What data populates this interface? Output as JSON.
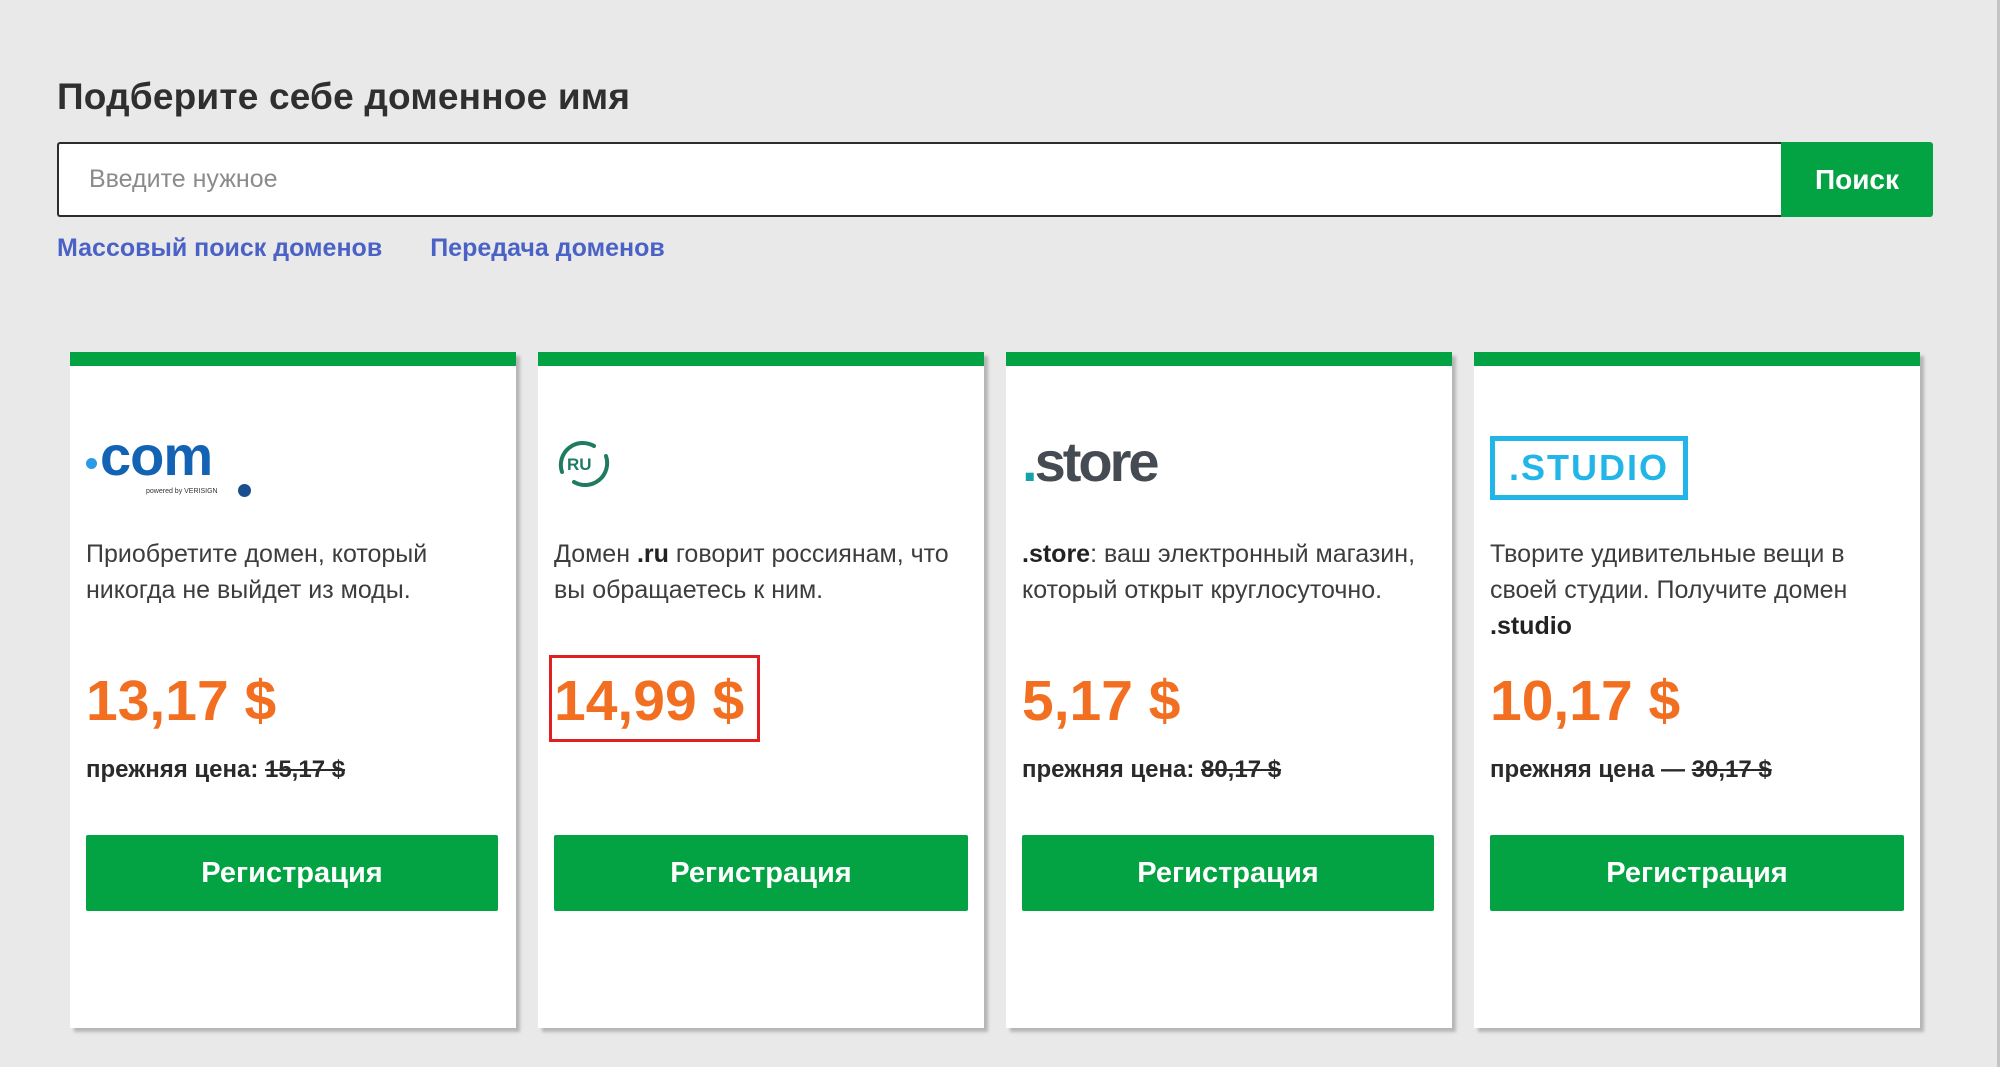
{
  "header": {
    "title": "Подберите себе доменное имя"
  },
  "search": {
    "placeholder": "Введите нужное",
    "value": "",
    "button_label": "Поиск"
  },
  "links": {
    "bulk_search": "Массовый поиск доменов",
    "transfer": "Передача доменов"
  },
  "colors": {
    "accent_green": "#03a344",
    "price_orange": "#f26f21",
    "link_blue": "#4a62c6",
    "highlight_red": "#e02020"
  },
  "cards": [
    {
      "zone": "com",
      "logo_text": "com",
      "logo_sub": "powered by VERISIGN",
      "desc": "Приобретите домен, который никогда не выйдет из моды.",
      "price": "13,17 $",
      "old_price_label": "прежняя цена:",
      "old_price_value": "15,17 $",
      "button_label": "Регистрация"
    },
    {
      "zone": "ru",
      "logo_text": "RU",
      "desc_prefix": "Домен ",
      "desc_bold": ".ru",
      "desc_suffix": " говорит россиянам, что вы обращаетесь к ним.",
      "price": "14,99 $",
      "price_highlighted": true,
      "button_label": "Регистрация"
    },
    {
      "zone": "store",
      "logo_text": "store",
      "desc_bold": ".store",
      "desc_suffix": ": ваш электронный магазин, который открыт круглосуточно.",
      "price": "5,17 $",
      "old_price_label": "прежняя цена:",
      "old_price_value": "80,17 $",
      "button_label": "Регистрация"
    },
    {
      "zone": "studio",
      "logo_text": ".STUDIO",
      "desc_prefix": "Творите удивительные вещи в своей студии. Получите домен ",
      "desc_bold": ".studio",
      "price": "10,17 $",
      "old_price_label": "прежняя цена —",
      "old_price_value": "30,17 $",
      "button_label": "Регистрация"
    }
  ]
}
